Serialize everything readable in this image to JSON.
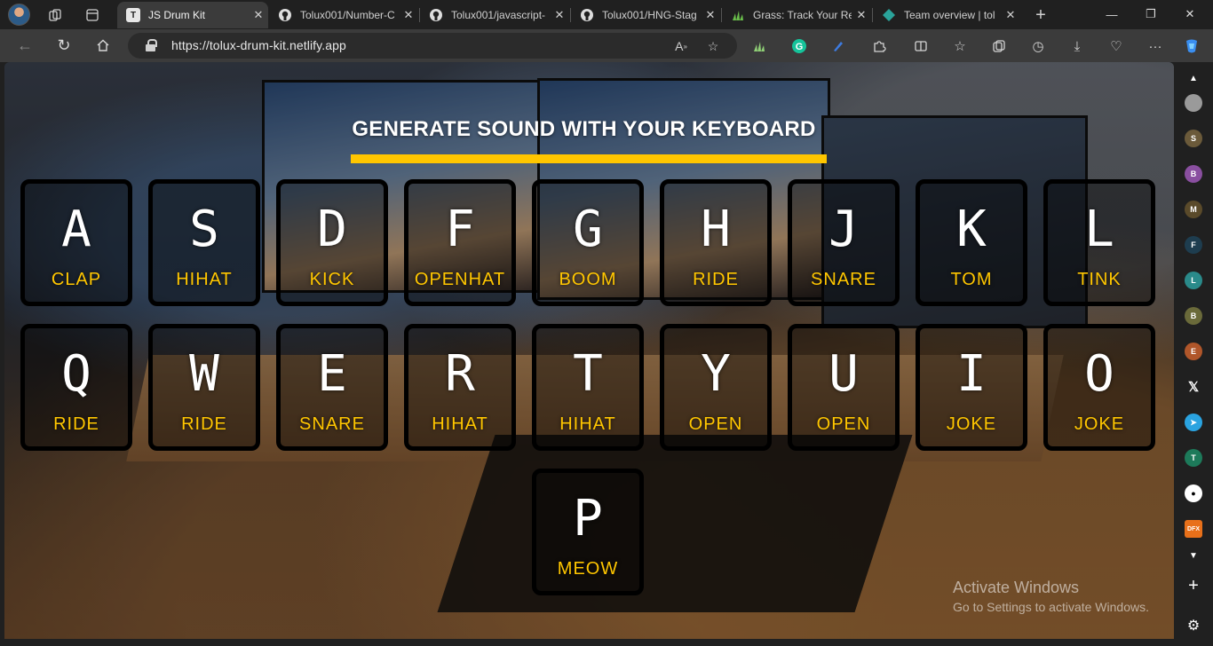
{
  "browser": {
    "tabs": [
      {
        "title": "JS Drum Kit",
        "favicon": "T",
        "active": true
      },
      {
        "title": "Tolux001/Number-C",
        "favicon": "github-icon",
        "active": false
      },
      {
        "title": "Tolux001/javascript-",
        "favicon": "github-icon",
        "active": false
      },
      {
        "title": "Tolux001/HNG-Stag",
        "favicon": "github-icon",
        "active": false
      },
      {
        "title": "Grass: Track Your Re",
        "favicon": "grass-icon",
        "active": false
      },
      {
        "title": "Team overview | tol",
        "favicon": "diamond-icon",
        "active": false
      }
    ],
    "url": "https://tolux-drum-kit.netlify.app",
    "side_panel_letters": [
      "S",
      "B",
      "M",
      "F",
      "L",
      "B",
      "E",
      "T"
    ]
  },
  "page": {
    "heading": "GENERATE SOUND WITH YOUR KEYBOARD",
    "accent_color": "#ffc600",
    "keys": [
      {
        "key": "A",
        "sound": "CLAP"
      },
      {
        "key": "S",
        "sound": "HIHAT"
      },
      {
        "key": "D",
        "sound": "KICK"
      },
      {
        "key": "F",
        "sound": "OPENHAT"
      },
      {
        "key": "G",
        "sound": "BOOM"
      },
      {
        "key": "H",
        "sound": "RIDE"
      },
      {
        "key": "J",
        "sound": "SNARE"
      },
      {
        "key": "K",
        "sound": "TOM"
      },
      {
        "key": "L",
        "sound": "TINK"
      },
      {
        "key": "Q",
        "sound": "RIDE"
      },
      {
        "key": "W",
        "sound": "RIDE"
      },
      {
        "key": "E",
        "sound": "SNARE"
      },
      {
        "key": "R",
        "sound": "HIHAT"
      },
      {
        "key": "T",
        "sound": "HIHAT"
      },
      {
        "key": "Y",
        "sound": "OPEN"
      },
      {
        "key": "U",
        "sound": "OPEN"
      },
      {
        "key": "I",
        "sound": "JOKE"
      },
      {
        "key": "O",
        "sound": "JOKE"
      },
      {
        "key": "P",
        "sound": "MEOW"
      }
    ]
  },
  "watermark": {
    "line1": "Activate Windows",
    "line2": "Go to Settings to activate Windows."
  }
}
